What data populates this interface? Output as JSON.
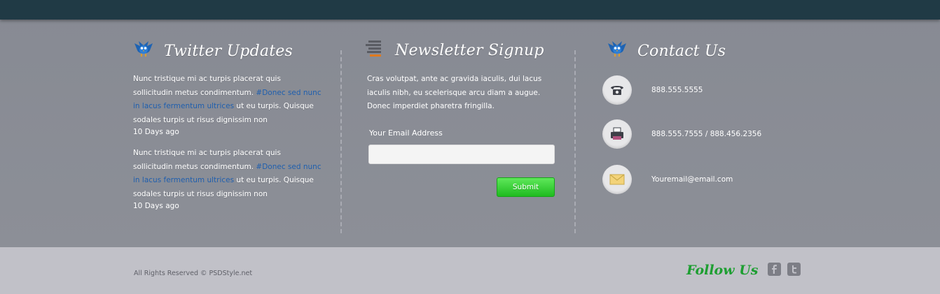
{
  "twitter": {
    "heading": "Twitter Updates",
    "tweets": [
      {
        "text_start": "Nunc tristique mi ac turpis placerat quis sollicitudin metus condimentum. ",
        "link": "#Donec sed nunc in lacus fermentum ultrices",
        "text_end": " ut eu turpis. Quisque sodales turpis ut risus dignissim non",
        "ago": "10 Days ago"
      },
      {
        "text_start": "Nunc tristique mi ac turpis placerat quis sollicitudin metus condimentum. ",
        "link": "#Donec sed nunc in lacus fermentum ultrices",
        "text_end": " ut eu turpis. Quisque sodales turpis ut risus dignissim non",
        "ago": "10 Days ago"
      }
    ]
  },
  "newsletter": {
    "heading": "Newsletter Signup",
    "text": "Cras volutpat, ante ac gravida iaculis, dui lacus iaculis nibh, eu scelerisque arcu diam a augue. Donec imperdiet pharetra fringilla.",
    "email_label": "Your Email Address",
    "email_value": "",
    "submit_label": "Submit"
  },
  "contact": {
    "heading": "Contact Us",
    "items": [
      {
        "icon": "phone-icon",
        "text": "888.555.5555"
      },
      {
        "icon": "fax-icon",
        "text": "888.555.7555 / 888.456.2356"
      },
      {
        "icon": "envelope-icon",
        "text": "Youremail@email.com"
      }
    ]
  },
  "footer": {
    "copyright": "All Rights Reserved © PSDStyle.net",
    "follow_label": "Follow Us",
    "social": [
      {
        "icon": "facebook-icon",
        "glyph": "f"
      },
      {
        "icon": "twitter-icon",
        "glyph": "t"
      }
    ]
  },
  "colors": {
    "topbar": "#203a45",
    "background": "#8d8f97",
    "footer": "#c1c1c8",
    "link": "#1f5fae",
    "accent_green": "#1d9e31"
  }
}
